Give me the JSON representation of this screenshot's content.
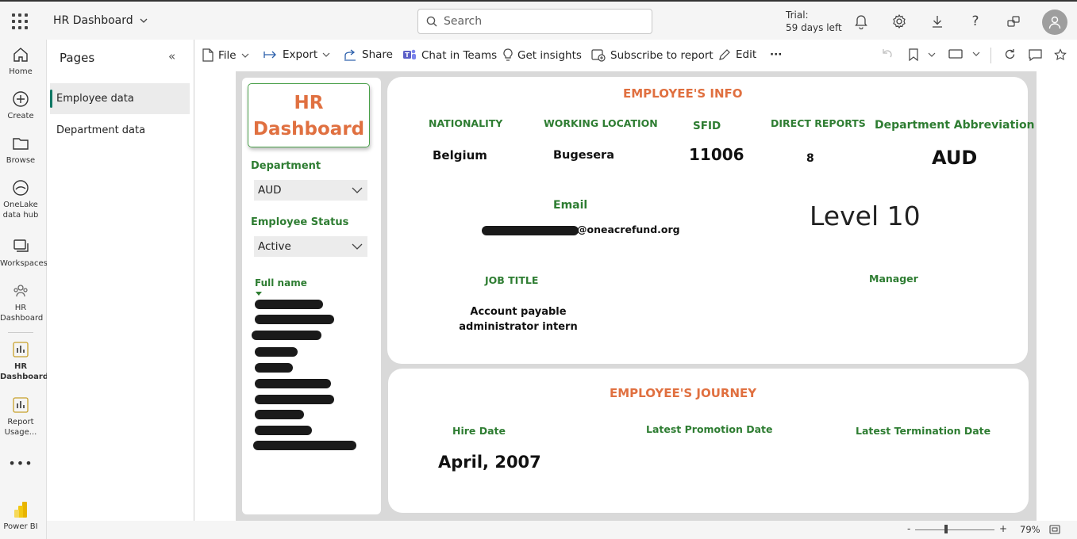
{
  "topbar": {
    "app_title": "HR Dashboard",
    "search_placeholder": "Search",
    "trial_line1": "Trial:",
    "trial_line2": "59 days left"
  },
  "rail": {
    "items": [
      {
        "label": "Home",
        "icon": "home-icon"
      },
      {
        "label": "Create",
        "icon": "plus-circle-icon"
      },
      {
        "label": "Browse",
        "icon": "folder-icon"
      },
      {
        "label_line1": "OneLake",
        "label_line2": "data hub",
        "icon": "onelake-icon"
      },
      {
        "label": "Workspaces",
        "icon": "workspaces-icon"
      },
      {
        "label_line1": "HR",
        "label_line2": "Dashboard",
        "icon": "workspace-people-icon"
      },
      {
        "label_line1": "HR",
        "label_line2": "Dashboard",
        "icon": "report-icon"
      },
      {
        "label_line1": "Report",
        "label_line2": "Usage...",
        "icon": "report-icon"
      },
      {
        "label": "Power BI",
        "icon": "powerbi-logo"
      }
    ]
  },
  "pages": {
    "title": "Pages",
    "items": [
      "Employee data",
      "Department data"
    ],
    "active": "Employee data"
  },
  "toolbar": {
    "file": "File",
    "export": "Export",
    "share": "Share",
    "chat": "Chat in Teams",
    "insights": "Get insights",
    "subscribe": "Subscribe to report",
    "edit": "Edit",
    "more": "···"
  },
  "report": {
    "title_line1": "HR",
    "title_line2": "Dashboard",
    "department_label": "Department",
    "department_value": "AUD",
    "status_label": "Employee Status",
    "status_value": "Active",
    "fullname_label": "Full name",
    "info": {
      "title": "EMPLOYEE'S INFO",
      "nationality_label": "NATIONALITY",
      "nationality": "Belgium",
      "location_label": "WORKING LOCATION",
      "location": "Bugesera",
      "sfid_label": "SFID",
      "sfid": "11006",
      "reports_label": "DIRECT REPORTS",
      "reports": "8",
      "dept_abbr_label": "Department Abbreviation",
      "dept_abbr": "AUD",
      "email_label": "Email",
      "email_domain": "@oneacrefund.org",
      "level": "Level 10",
      "job_label": "JOB TITLE",
      "job_line1": "Account payable",
      "job_line2": "administrator intern",
      "manager_label": "Manager"
    },
    "journey": {
      "title": "EMPLOYEE'S JOURNEY",
      "hire_label": "Hire Date",
      "hire_date": "April, 2007",
      "promotion_label": "Latest Promotion Date",
      "termination_label": "Latest Termination Date"
    }
  },
  "status": {
    "minus": "-",
    "plus": "+",
    "zoom": "79%"
  }
}
